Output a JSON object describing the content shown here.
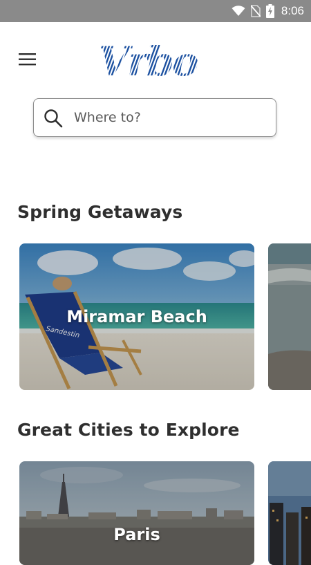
{
  "status_bar": {
    "time": "8:06",
    "icons": [
      "wifi-icon",
      "no-sim-icon",
      "battery-charging-icon"
    ]
  },
  "header": {
    "menu_icon": "hamburger-menu-icon",
    "logo_text": "Vrbo",
    "brand_color": "#1b50a0"
  },
  "search": {
    "icon": "search-icon",
    "placeholder": "Where to?",
    "value": ""
  },
  "sections": [
    {
      "title": "Spring Getaways",
      "cards": [
        {
          "label": "Miramar Beach"
        },
        {
          "label": ""
        }
      ]
    },
    {
      "title": "Great Cities to Explore",
      "cards": [
        {
          "label": "Paris"
        },
        {
          "label": ""
        }
      ]
    }
  ]
}
